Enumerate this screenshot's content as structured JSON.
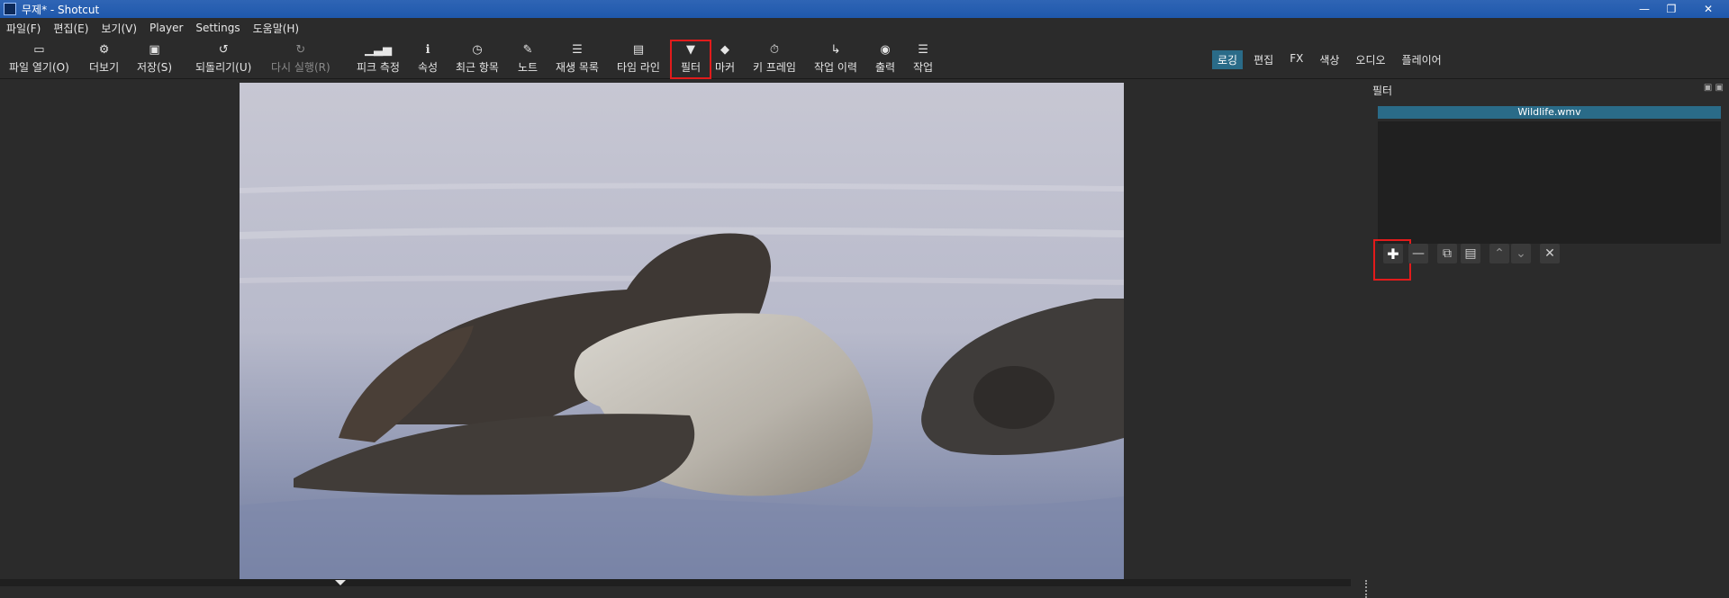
{
  "window": {
    "title": "무제* - Shotcut"
  },
  "menu": {
    "items": [
      "파일(F)",
      "편집(E)",
      "보기(V)",
      "Player",
      "Settings",
      "도움말(H)"
    ]
  },
  "toolbar": {
    "items": [
      {
        "label": "파일 열기(O)",
        "icon": "folder-icon"
      },
      {
        "label": "더보기",
        "icon": "more-icon"
      },
      {
        "label": "저장(S)",
        "icon": "save-icon"
      },
      {
        "label": "되돌리기(U)",
        "icon": "undo-icon"
      },
      {
        "label": "다시 실행(R)",
        "icon": "redo-icon",
        "disabled": true
      },
      {
        "label": "피크 측정",
        "icon": "peak-meter-icon"
      },
      {
        "label": "속성",
        "icon": "info-icon"
      },
      {
        "label": "최근 항목",
        "icon": "clock-icon"
      },
      {
        "label": "노트",
        "icon": "note-icon"
      },
      {
        "label": "재생 목록",
        "icon": "list-icon"
      },
      {
        "label": "타임 라인",
        "icon": "timeline-icon"
      },
      {
        "label": "필터",
        "icon": "filter-icon",
        "highlighted": true
      },
      {
        "label": "마커",
        "icon": "marker-icon"
      },
      {
        "label": "키 프레임",
        "icon": "stopwatch-icon"
      },
      {
        "label": "작업 이력",
        "icon": "history-icon"
      },
      {
        "label": "출력",
        "icon": "disc-icon"
      },
      {
        "label": "작업",
        "icon": "jobs-icon"
      }
    ]
  },
  "layouts": {
    "items": [
      "로깅",
      "편집",
      "FX",
      "색상",
      "오디오",
      "플레이어"
    ],
    "active_index": 0
  },
  "filters_panel": {
    "title": "필터",
    "clip_name": "Wildlife.wmv",
    "buttons": [
      "add-filter",
      "remove-filter",
      "copy-filter",
      "paste-filter",
      "move-up",
      "move-down",
      "deselect"
    ]
  },
  "colors": {
    "accent": "#2a6b88",
    "highlight_box": "#e21b1b"
  }
}
